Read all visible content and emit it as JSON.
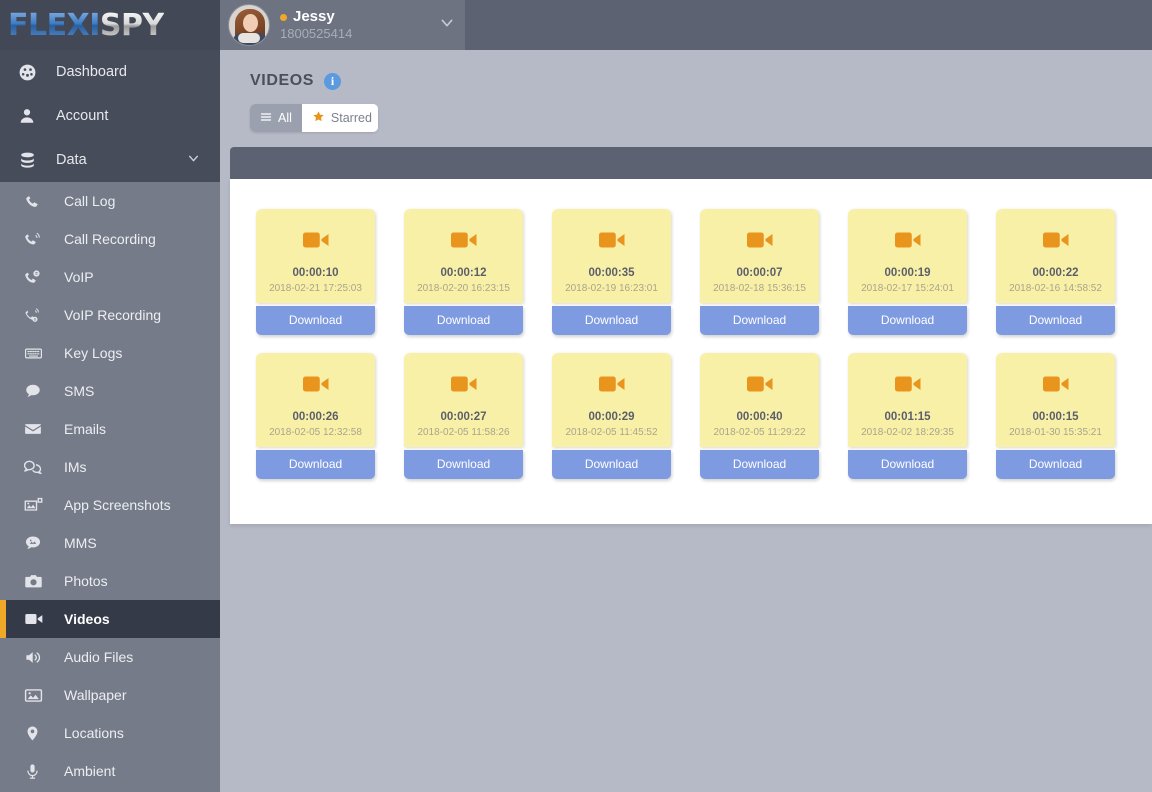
{
  "brand": {
    "part1": "FLEXI",
    "part2": "SPY"
  },
  "profile": {
    "name": "Jessy",
    "phone": "1800525414",
    "avatar_icon": "user-avatar-photo",
    "status_icon": "online-status-dot",
    "chevron_icon": "chevron-down-icon"
  },
  "sidebar": {
    "top_items": [
      {
        "label": "Dashboard",
        "icon": "dashboard-icon"
      },
      {
        "label": "Account",
        "icon": "user-icon"
      },
      {
        "label": "Data",
        "icon": "database-icon",
        "chevron": "chevron-down-icon"
      }
    ],
    "sub_items": [
      {
        "label": "Call Log",
        "icon": "phone-icon"
      },
      {
        "label": "Call Recording",
        "icon": "phone-recording-icon"
      },
      {
        "label": "VoIP",
        "icon": "voip-icon"
      },
      {
        "label": "VoIP Recording",
        "icon": "voip-recording-icon"
      },
      {
        "label": "Key Logs",
        "icon": "keyboard-icon"
      },
      {
        "label": "SMS",
        "icon": "chat-bubble-icon"
      },
      {
        "label": "Emails",
        "icon": "envelope-icon"
      },
      {
        "label": "IMs",
        "icon": "chat-bubbles-icon"
      },
      {
        "label": "App Screenshots",
        "icon": "screenshot-icon"
      },
      {
        "label": "MMS",
        "icon": "mms-icon"
      },
      {
        "label": "Photos",
        "icon": "camera-icon"
      },
      {
        "label": "Videos",
        "icon": "video-camera-icon",
        "active": true
      },
      {
        "label": "Audio Files",
        "icon": "speaker-icon"
      },
      {
        "label": "Wallpaper",
        "icon": "image-icon"
      },
      {
        "label": "Locations",
        "icon": "map-pin-icon"
      },
      {
        "label": "Ambient",
        "icon": "microphone-icon"
      }
    ]
  },
  "page": {
    "title": "VIDEOS",
    "info_icon": "info-icon",
    "filters": [
      {
        "label": "All",
        "icon": "list-icon",
        "active": true
      },
      {
        "label": "Starred",
        "icon": "star-icon",
        "active": false
      }
    ]
  },
  "videos": {
    "download_label": "Download",
    "item_icon": "video-camera-icon",
    "items": [
      {
        "duration": "00:00:10",
        "datetime": "2018-02-21 17:25:03"
      },
      {
        "duration": "00:00:12",
        "datetime": "2018-02-20 16:23:15"
      },
      {
        "duration": "00:00:35",
        "datetime": "2018-02-19 16:23:01"
      },
      {
        "duration": "00:00:07",
        "datetime": "2018-02-18 15:36:15"
      },
      {
        "duration": "00:00:19",
        "datetime": "2018-02-17 15:24:01"
      },
      {
        "duration": "00:00:22",
        "datetime": "2018-02-16 14:58:52"
      },
      {
        "duration": "00:00:26",
        "datetime": "2018-02-05 12:32:58"
      },
      {
        "duration": "00:00:27",
        "datetime": "2018-02-05 11:58:26"
      },
      {
        "duration": "00:00:29",
        "datetime": "2018-02-05 11:45:52"
      },
      {
        "duration": "00:00:40",
        "datetime": "2018-02-05 11:29:22"
      },
      {
        "duration": "00:01:15",
        "datetime": "2018-02-02 18:29:35"
      },
      {
        "duration": "00:00:15",
        "datetime": "2018-01-30 15:35:21"
      }
    ]
  },
  "colors": {
    "sidebar_bg": "#767b89",
    "sidebar_dark": "#474c5b",
    "active_item": "#353a49",
    "accent_orange": "#f0a828",
    "card_yellow": "#f9f0a7",
    "download_blue": "#7e9ae0",
    "video_icon_orange": "#e8941d",
    "page_bg": "#b6bac6"
  }
}
